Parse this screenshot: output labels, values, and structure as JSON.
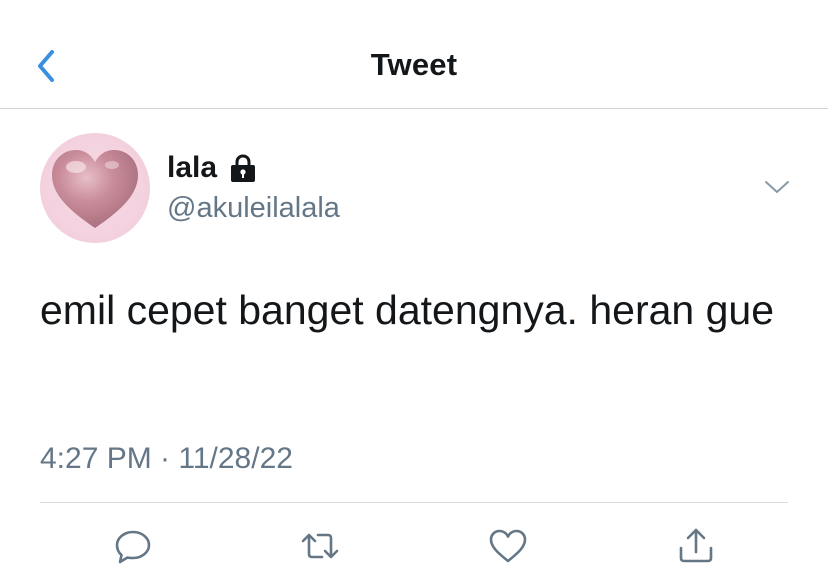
{
  "nav": {
    "title": "Tweet",
    "back_icon": "chevron-left-icon",
    "accent_color": "#3a8fe0"
  },
  "tweet": {
    "author": {
      "display_name": "lala",
      "handle": "@akuleilalala",
      "protected_icon": "lock-icon",
      "avatar": "pink-heart-avatar"
    },
    "text": "emil cepet banget datengnya. heran gue",
    "timestamp": "4:27 PM · 11/28/22",
    "menu_icon": "chevron-down-icon"
  },
  "actions": [
    {
      "name": "reply",
      "icon": "reply-icon"
    },
    {
      "name": "retweet",
      "icon": "retweet-icon"
    },
    {
      "name": "like",
      "icon": "heart-icon"
    },
    {
      "name": "share",
      "icon": "share-icon"
    }
  ],
  "colors": {
    "text_primary": "#14171a",
    "text_secondary": "#657786",
    "icon_gray": "#657786",
    "divider": "#d8dde1"
  }
}
